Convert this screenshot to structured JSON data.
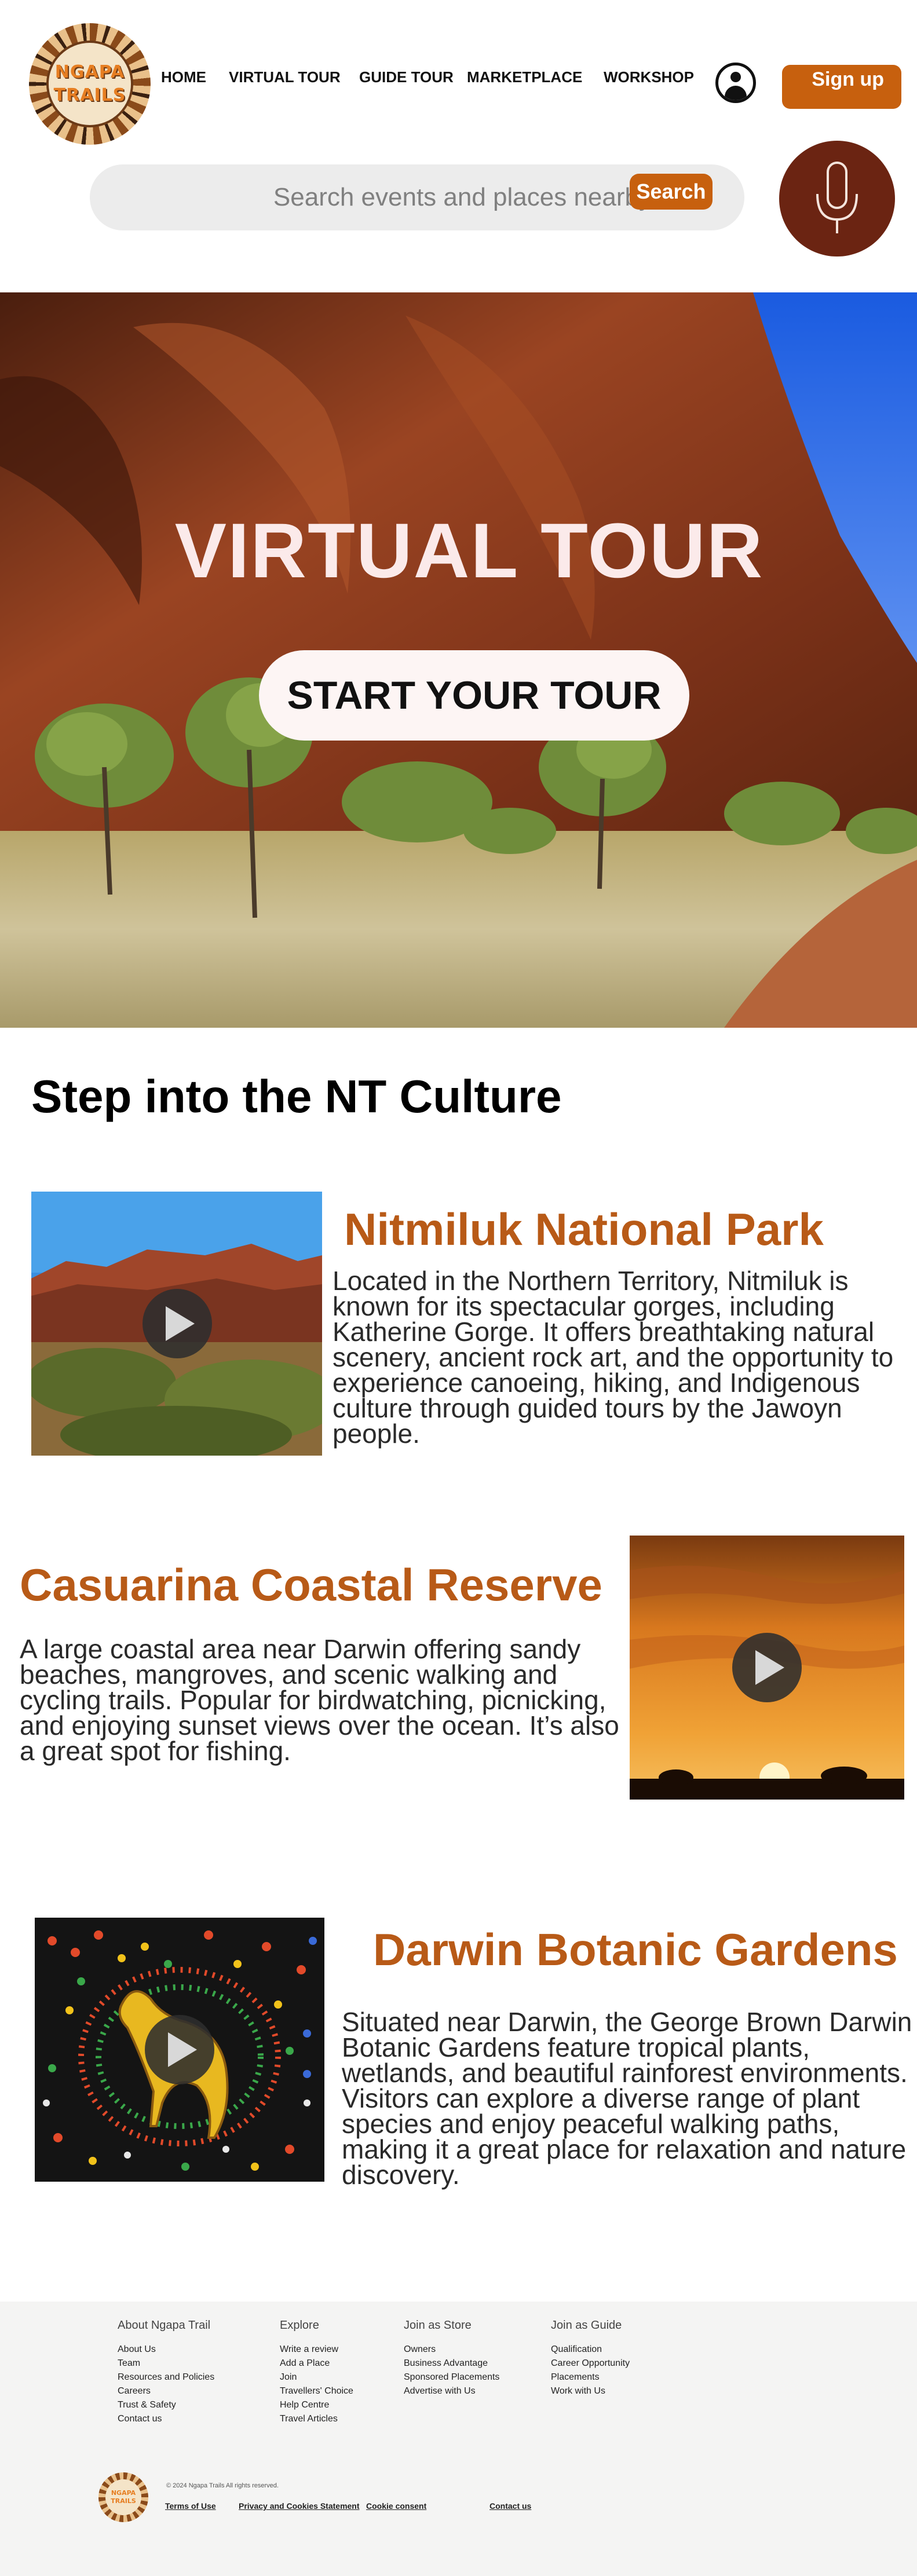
{
  "brand": {
    "logo_line1": "NGAPA",
    "logo_line2": "TRAILS"
  },
  "nav": {
    "items": [
      {
        "label": "HOME"
      },
      {
        "label": "VIRTUAL TOUR"
      },
      {
        "label": "GUIDE TOUR"
      },
      {
        "label": "MARKETPLACE"
      },
      {
        "label": "WORKSHOP"
      }
    ],
    "signup_label": "Sign up"
  },
  "search": {
    "placeholder": "Search events and places nearby",
    "button_label": "Search"
  },
  "colors": {
    "accent": "#c7600e",
    "mic_bg": "#6b2412",
    "title_orange": "#b85a17",
    "footer_bg": "#f4f4f3"
  },
  "icons": {
    "account": "user-circle-icon",
    "voice": "microphone-icon",
    "video": "play-icon"
  },
  "hero": {
    "title": "VIRTUAL TOUR",
    "button_label": "START YOUR TOUR"
  },
  "culture": {
    "title": "Step into the NT Culture",
    "places": [
      {
        "name": "Nitmiluk National Park",
        "description": "Located in the Northern Territory, Nitmiluk is known for its spectacular gorges, including Katherine Gorge. It offers breathtaking natural scenery, ancient rock art, and the opportunity to experience canoeing, hiking,  and Indigenous culture through guided tours by the Jawoyn people."
      },
      {
        "name": "Casuarina Coastal Reserve",
        "description": "A large coastal area near Darwin offering sandy beaches, mangroves, and scenic walking and cycling trails. Popular for birdwatching, picnicking, and enjoying sunset views over the ocean. It’s also a great spot for fishing."
      },
      {
        "name": "Darwin Botanic Gardens",
        "description": "Situated near Darwin, the George Brown Darwin Botanic Gardens feature tropical plants, wetlands, and beautiful rainforest environments. Visitors can explore a diverse range of plant species and enjoy peaceful walking paths, making it a great place for relaxation and nature discovery."
      }
    ]
  },
  "footer": {
    "columns": [
      {
        "heading": "About Ngapa Trail",
        "links": [
          "About Us",
          "Team",
          "Resources and Policies",
          "Careers",
          "Trust & Safety",
          "Contact us"
        ]
      },
      {
        "heading": "Explore",
        "links": [
          "Write a review",
          "Add a Place",
          "Join",
          "Travellers' Choice",
          "Help Centre",
          "Travel Articles"
        ]
      },
      {
        "heading": "Join as Store",
        "links": [
          "Owners",
          "Business Advantage",
          "Sponsored Placements",
          "Advertise with Us"
        ]
      },
      {
        "heading": "Join as Guide",
        "links": [
          "Qualification",
          "Career Opportunity",
          "Placements",
          "Work with Us"
        ]
      }
    ],
    "copyright": "© 2024 Ngapa Trails All rights reserved.",
    "legal": {
      "terms": "Terms of Use",
      "privacy": "Privacy and Cookies Statement",
      "cookie": "Cookie consent",
      "contact": "Contact us"
    }
  }
}
